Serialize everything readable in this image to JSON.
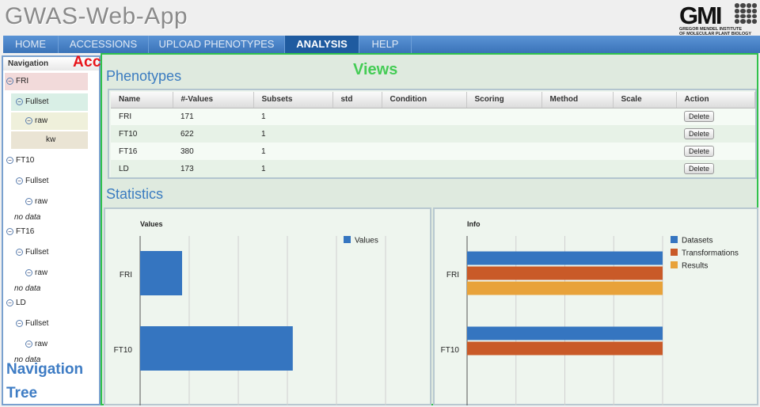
{
  "app": {
    "title": "GWAS-Web-App"
  },
  "logo": {
    "text": "GMI",
    "subtitle_line1": "GREGOR MENDEL INSTITUTE",
    "subtitle_line2": "OF MOLECULAR PLANT BIOLOGY"
  },
  "tabs": [
    {
      "label": "HOME"
    },
    {
      "label": "ACCESSIONS"
    },
    {
      "label": "UPLOAD PHENOTYPES"
    },
    {
      "label": "ANALYSIS",
      "active": true
    },
    {
      "label": "HELP"
    }
  ],
  "navigation": {
    "heading": "Navigation",
    "nodes": [
      {
        "label": "FRI",
        "icon": "collapse-icon"
      },
      {
        "label": "Fullset",
        "icon": "collapse-icon"
      },
      {
        "label": "raw",
        "icon": "collapse-icon"
      },
      {
        "label": "kw"
      },
      {
        "label": "FT10",
        "icon": "collapse-icon"
      },
      {
        "label": "Fullset",
        "icon": "collapse-icon"
      },
      {
        "label": "raw",
        "icon": "collapse-icon"
      },
      {
        "label": "no data"
      },
      {
        "label": "FT16",
        "icon": "collapse-icon"
      },
      {
        "label": "Fullset",
        "icon": "collapse-icon"
      },
      {
        "label": "raw",
        "icon": "collapse-icon"
      },
      {
        "label": "no data"
      },
      {
        "label": "LD",
        "icon": "collapse-icon"
      },
      {
        "label": "Fullset",
        "icon": "collapse-icon"
      },
      {
        "label": "raw",
        "icon": "collapse-icon"
      },
      {
        "label": "no data"
      }
    ]
  },
  "annotations": {
    "access": "Access  to Views",
    "views": "Views",
    "nav_line1": "Navigation",
    "nav_line2": "Tree"
  },
  "phenotypes": {
    "title": "Phenotypes",
    "columns": [
      "Name",
      "#-Values",
      "Subsets",
      "std",
      "Condition",
      "Scoring",
      "Method",
      "Scale",
      "Action"
    ],
    "rows": [
      {
        "name": "FRI",
        "values": "171",
        "subsets": "1",
        "action": "Delete"
      },
      {
        "name": "FT10",
        "values": "622",
        "subsets": "1",
        "action": "Delete"
      },
      {
        "name": "FT16",
        "values": "380",
        "subsets": "1",
        "action": "Delete"
      },
      {
        "name": "LD",
        "values": "173",
        "subsets": "1",
        "action": "Delete"
      }
    ]
  },
  "statistics": {
    "title": "Statistics"
  },
  "colors": {
    "blue": "#3575c0",
    "orange": "#c95a28",
    "yellow": "#e8a23a",
    "views_border": "#31c24c",
    "tab_bar": "#3a73b8"
  },
  "chart_data": [
    {
      "type": "bar",
      "orientation": "horizontal",
      "title": "Values",
      "categories": [
        "FRI",
        "FT10"
      ],
      "series": [
        {
          "name": "Values",
          "values": [
            171,
            622
          ]
        }
      ],
      "xlim": [
        0,
        1000
      ],
      "legend": "top-right",
      "grid": true
    },
    {
      "type": "bar",
      "orientation": "horizontal",
      "title": "Info",
      "categories": [
        "FRI",
        "FT10"
      ],
      "series": [
        {
          "name": "Datasets",
          "values": [
            1,
            1
          ]
        },
        {
          "name": "Transformations",
          "values": [
            1,
            1
          ]
        },
        {
          "name": "Results",
          "values": [
            1,
            0
          ]
        }
      ],
      "xlim": [
        0,
        1
      ],
      "legend": "top-right",
      "grid": true
    }
  ]
}
